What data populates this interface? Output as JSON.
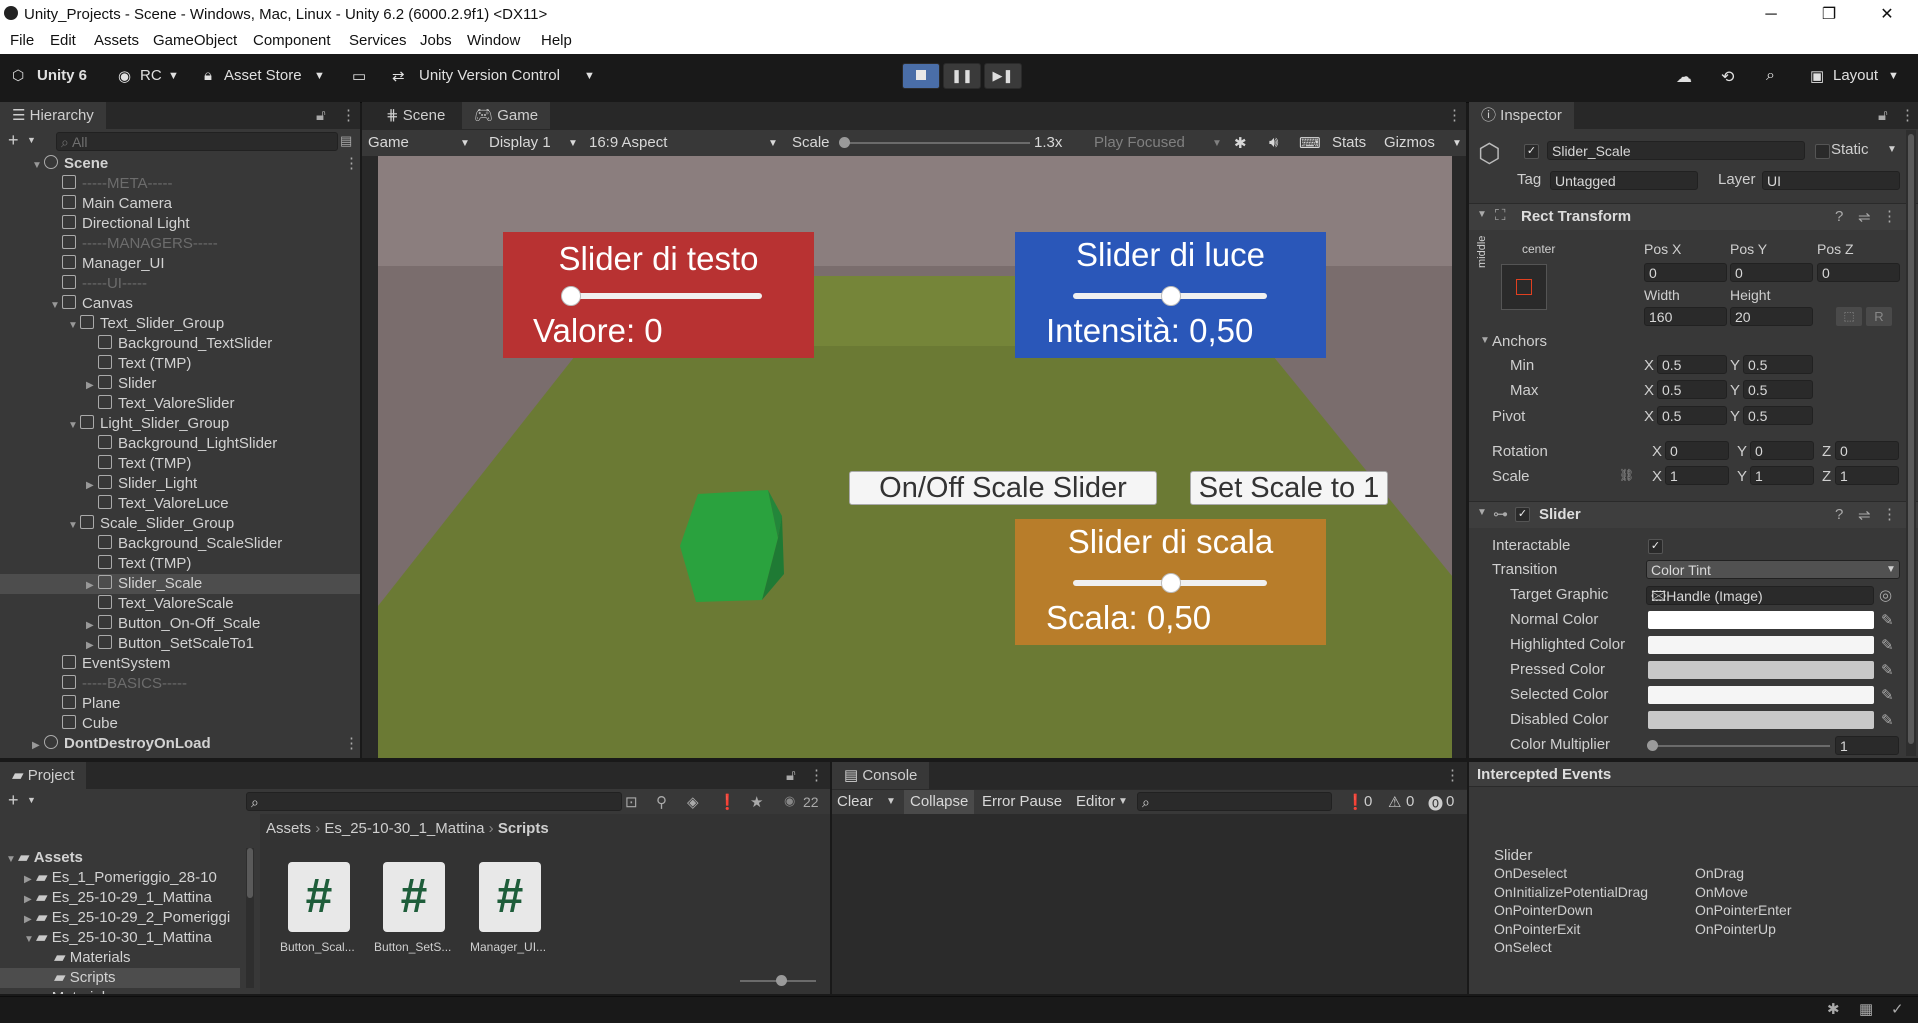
{
  "window": {
    "title": "Unity_Projects - Scene - Windows, Mac, Linux - Unity 6.2 (6000.2.9f1) <DX11>",
    "minimize": "─",
    "restore": "❐",
    "close": "✕"
  },
  "menu": [
    "File",
    "Edit",
    "Assets",
    "GameObject",
    "Component",
    "Services",
    "Jobs",
    "Window",
    "Help"
  ],
  "toolbar": {
    "unity": "Unity 6",
    "account": "RC",
    "asset_store": "Asset Store",
    "version_control": "Unity Version Control",
    "layout": "Layout"
  },
  "hierarchy": {
    "tab": "Hierarchy",
    "search_placeholder": "All",
    "rows": [
      {
        "label": "Scene",
        "depth": 0
      },
      {
        "label": "-----META-----",
        "depth": 1
      },
      {
        "label": "Main Camera",
        "depth": 1
      },
      {
        "label": "Directional Light",
        "depth": 1
      },
      {
        "label": "-----MANAGERS-----",
        "depth": 1
      },
      {
        "label": "Manager_UI",
        "depth": 1
      },
      {
        "label": "-----UI-----",
        "depth": 1
      },
      {
        "label": "Canvas",
        "depth": 1
      },
      {
        "label": "Text_Slider_Group",
        "depth": 2
      },
      {
        "label": "Background_TextSlider",
        "depth": 3
      },
      {
        "label": "Text (TMP)",
        "depth": 3
      },
      {
        "label": "Slider",
        "depth": 3
      },
      {
        "label": "Text_ValoreSlider",
        "depth": 3
      },
      {
        "label": "Light_Slider_Group",
        "depth": 2
      },
      {
        "label": "Background_LightSlider",
        "depth": 3
      },
      {
        "label": "Text (TMP)",
        "depth": 3
      },
      {
        "label": "Slider_Light",
        "depth": 3
      },
      {
        "label": "Text_ValoreLuce",
        "depth": 3
      },
      {
        "label": "Scale_Slider_Group",
        "depth": 2
      },
      {
        "label": "Background_ScaleSlider",
        "depth": 3
      },
      {
        "label": "Text (TMP)",
        "depth": 3
      },
      {
        "label": "Slider_Scale",
        "depth": 3
      },
      {
        "label": "Text_ValoreScale",
        "depth": 3
      },
      {
        "label": "Button_On-Off_Scale",
        "depth": 3
      },
      {
        "label": "Button_SetScaleTo1",
        "depth": 3
      },
      {
        "label": "EventSystem",
        "depth": 1
      },
      {
        "label": "-----BASICS-----",
        "depth": 1
      },
      {
        "label": "Plane",
        "depth": 1
      },
      {
        "label": "Cube",
        "depth": 1
      },
      {
        "label": "DontDestroyOnLoad",
        "depth": 0
      }
    ]
  },
  "views": {
    "scene_tab": "Scene",
    "game_tab": "Game",
    "game_dropdown": "Game",
    "display": "Display 1",
    "aspect": "16:9 Aspect",
    "scale_label": "Scale",
    "scale_value": "1.3x",
    "scale_fraction": 0.0,
    "play_focused": "Play Focused",
    "stats": "Stats",
    "gizmos": "Gizmos"
  },
  "game": {
    "text_slider_title": "Slider di testo",
    "text_slider_value_label": "Valore: 0",
    "text_slider_fraction": 0.0,
    "light_slider_title": "Slider di luce",
    "light_slider_value_label": "Intensità: 0,50",
    "light_slider_fraction": 0.5,
    "scale_slider_title": "Slider di scala",
    "scale_slider_value_label": "Scala: 0,50",
    "scale_slider_fraction": 0.5,
    "onoff_button": "On/Off Scale Slider",
    "setscale_button": "Set Scale to 1",
    "colors": {
      "red": "#b83232",
      "blue": "#2a57b9",
      "orange": "#b87d2a",
      "cube": "#2a9a3c"
    }
  },
  "inspector": {
    "tab": "Inspector",
    "object_name": "Slider_Scale",
    "static_label": "Static",
    "tag_label": "Tag",
    "tag_value": "Untagged",
    "layer_label": "Layer",
    "layer_value": "UI",
    "rect_transform": "Rect Transform",
    "anchor_h": "center",
    "anchor_v": "middle",
    "pos_x_label": "Pos X",
    "pos_y_label": "Pos Y",
    "pos_z_label": "Pos Z",
    "pos_x": "0",
    "pos_y": "0",
    "pos_z": "0",
    "width_label": "Width",
    "height_label": "Height",
    "width": "160",
    "height": "20",
    "r_label": "R",
    "anchors": "Anchors",
    "min": "Min",
    "max": "Max",
    "pivot": "Pivot",
    "min_x": "0.5",
    "min_y": "0.5",
    "max_x": "0.5",
    "max_y": "0.5",
    "pivot_x": "0.5",
    "pivot_y": "0.5",
    "rotation": "Rotation",
    "rot_x": "0",
    "rot_y": "0",
    "rot_z": "0",
    "scale": "Scale",
    "scale_x": "1",
    "scale_y": "1",
    "scale_z": "1",
    "x": "X",
    "y": "Y",
    "z": "Z",
    "slider_component": "Slider",
    "interactable": "Interactable",
    "transition": "Transition",
    "transition_value": "Color Tint",
    "target_graphic": "Target Graphic",
    "target_graphic_value": "Handle (Image)",
    "normal_color": "Normal Color",
    "highlighted_color": "Highlighted Color",
    "pressed_color": "Pressed Color",
    "selected_color": "Selected Color",
    "disabled_color": "Disabled Color",
    "color_multiplier": "Color Multiplier",
    "color_multiplier_value": "1",
    "colors": {
      "normal": "#ffffff",
      "highlighted": "#f5f5f5",
      "pressed": "#c8c8c8",
      "selected": "#f5f5f5",
      "disabled": "#c8c8c8"
    }
  },
  "intercepted": {
    "title": "Intercepted Events",
    "group": "Slider",
    "left": [
      "OnDeselect",
      "OnInitializePotentialDrag",
      "OnPointerDown",
      "OnPointerExit",
      "OnSelect"
    ],
    "right": [
      "OnDrag",
      "OnMove",
      "OnPointerEnter",
      "OnPointerUp"
    ]
  },
  "project": {
    "tab": "Project",
    "hidden_count": "22",
    "tree": [
      {
        "label": "Assets",
        "depth": 0
      },
      {
        "label": "Es_1_Pomeriggio_28-10",
        "depth": 1
      },
      {
        "label": "Es_25-10-29_1_Mattina",
        "depth": 1
      },
      {
        "label": "Es_25-10-29_2_Pomeriggi",
        "depth": 1
      },
      {
        "label": "Es_25-10-30_1_Mattina",
        "depth": 1
      },
      {
        "label": "Materials",
        "depth": 2
      },
      {
        "label": "Scripts",
        "depth": 2
      },
      {
        "label": "Materials",
        "depth": 1
      }
    ],
    "breadcrumb": [
      "Assets",
      "Es_25-10-30_1_Mattina",
      "Scripts"
    ],
    "files": [
      "Button_Scal...",
      "Button_SetS...",
      "Manager_UI..."
    ],
    "script_glyph": "#"
  },
  "console": {
    "tab": "Console",
    "clear": "Clear",
    "collapse": "Collapse",
    "error_pause": "Error Pause",
    "editor": "Editor",
    "info_count": "0",
    "warn_count": "0",
    "error_count": "0"
  }
}
